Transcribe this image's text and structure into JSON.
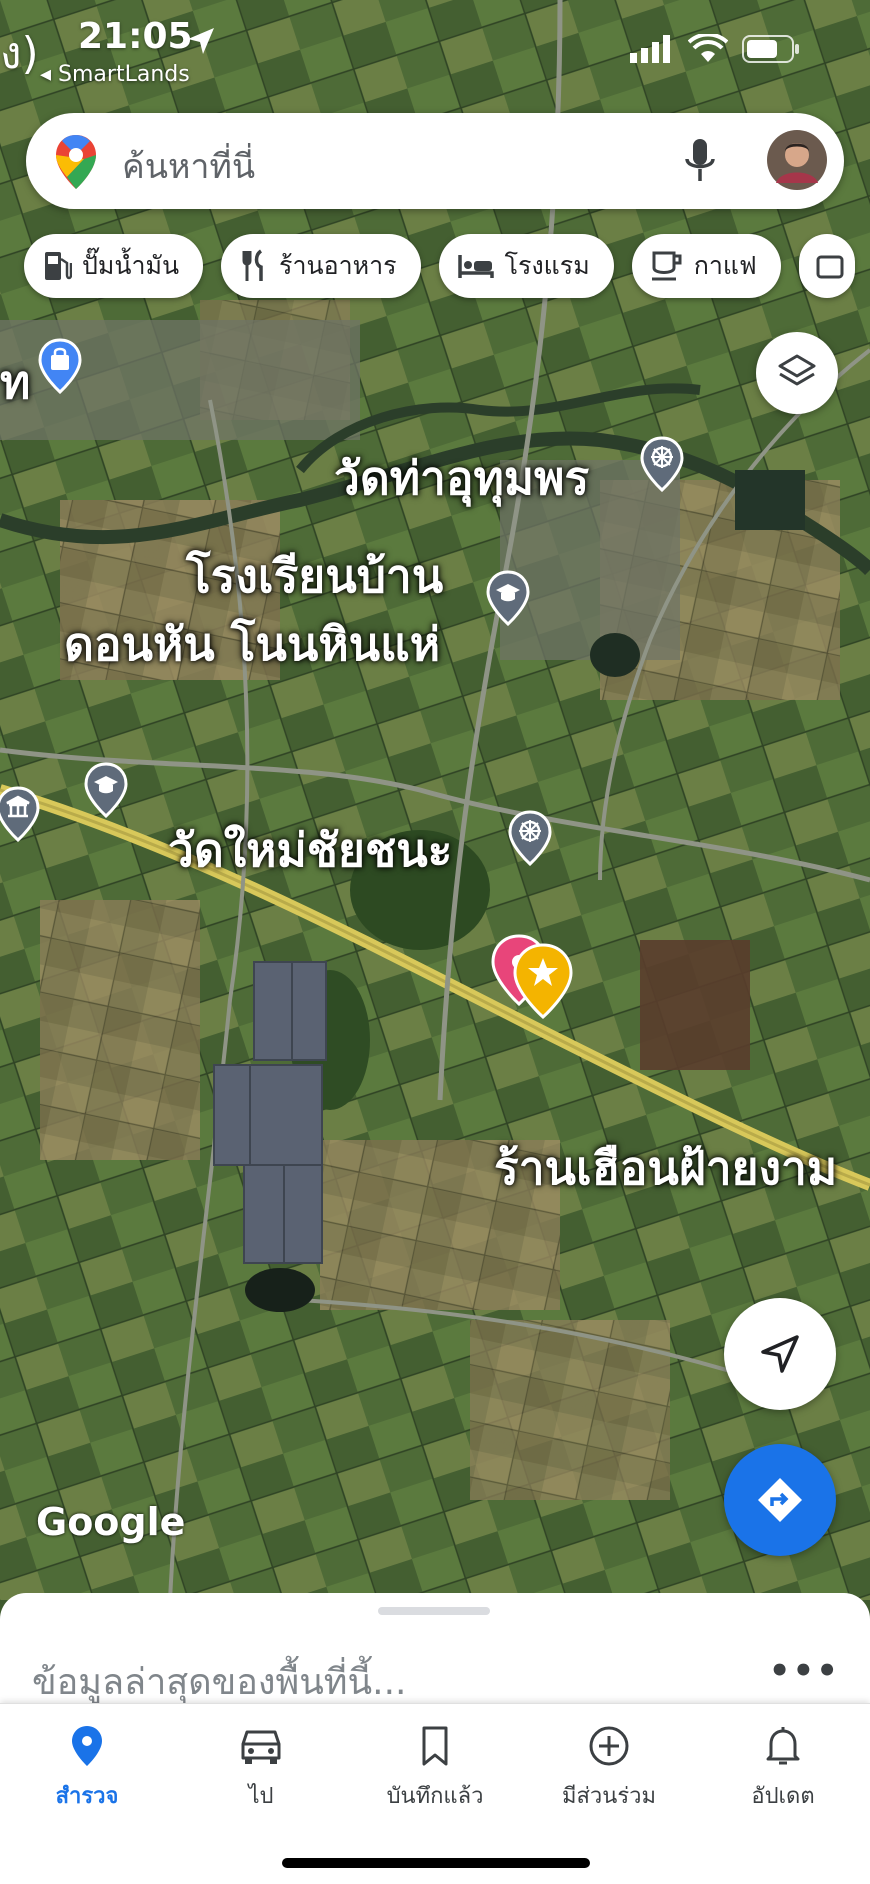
{
  "status": {
    "edge_text": "ง)",
    "time": "21:05",
    "back_app": "◂ SmartLands"
  },
  "search": {
    "placeholder": "ค้นหาที่นี่"
  },
  "chips": [
    {
      "label": "ปั๊มน้ำมัน",
      "icon": "gas-station-icon"
    },
    {
      "label": "ร้านอาหาร",
      "icon": "restaurant-icon"
    },
    {
      "label": "โรงแรม",
      "icon": "hotel-icon"
    },
    {
      "label": "กาแฟ",
      "icon": "coffee-icon"
    }
  ],
  "map": {
    "left_edge_label": "ท",
    "labels": {
      "temple1": "วัดท่าอุทุมพร",
      "school_line1": "โรงเรียนบ้าน",
      "school_line2": "ดอนหัน โนนหินแห่",
      "temple2": "วัดใหม่ชัยชนะ",
      "shop": "ร้านเฮือนฝ้ายงาม"
    },
    "attribution": "Google"
  },
  "sheet": {
    "title": "ข้อมูลล่าสุดของพื้นที่นี้...",
    "more": "•••"
  },
  "tabs": [
    {
      "label": "สำรวจ",
      "icon": "explore-pin-icon",
      "active": true
    },
    {
      "label": "ไป",
      "icon": "car-icon",
      "active": false
    },
    {
      "label": "บันทึกแล้ว",
      "icon": "bookmark-icon",
      "active": false
    },
    {
      "label": "มีส่วนร่วม",
      "icon": "contribute-plus-icon",
      "active": false
    },
    {
      "label": "อัปเดต",
      "icon": "bell-icon",
      "active": false
    }
  ],
  "colors": {
    "accent_blue": "#1a73e8",
    "pin_gray": "#5f6b7a",
    "road_yellow": "#d8c85a",
    "star_pin": "#f4b400",
    "saved_pin": "#e8457a"
  }
}
